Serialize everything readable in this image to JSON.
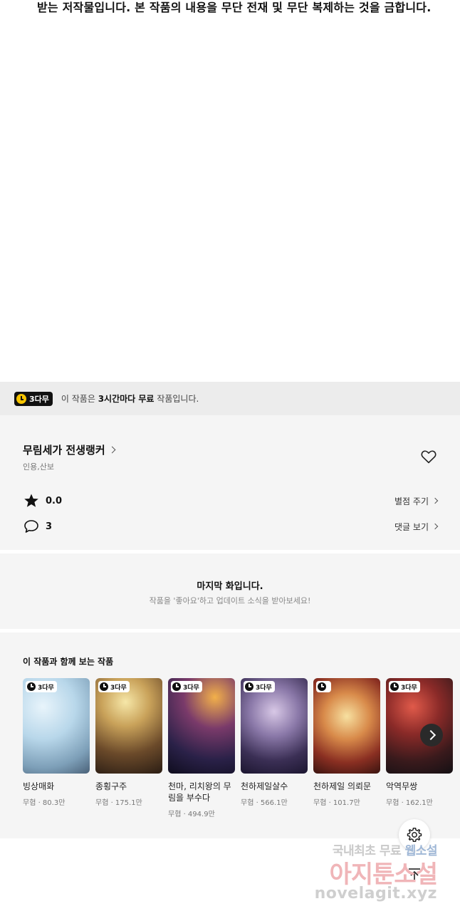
{
  "copyright_line": "받는 저작물입니다. 본 작품의 내용을 무단 전재 및 무단 복제하는 것을 금합니다.",
  "free_banner": {
    "badge": "3다무",
    "prefix": "이 작품은 ",
    "bold": "3시간마다 무료",
    "suffix": " 작품입니다."
  },
  "series": {
    "title": "무림세가 전생랭커",
    "authors": "인용,산보",
    "rating": "0.0",
    "rate_action": "별점 주기",
    "comments": "3",
    "comments_action": "댓글 보기"
  },
  "last_episode": {
    "title": "마지막 화입니다.",
    "subtitle": "작품을 '좋아요'하고 업데이트 소식을 받아보세요!"
  },
  "recommendations": {
    "heading": "이 작품과 함께 보는 작품",
    "badge": "3다무",
    "items": [
      {
        "name": "빙상매화",
        "meta": "무협 · 80.3만"
      },
      {
        "name": "종횡구주",
        "meta": "무협 · 175.1만"
      },
      {
        "name": "천마, 리치왕의 무림을 부수다",
        "meta": "무협 · 494.9만"
      },
      {
        "name": "천하제일살수",
        "meta": "무협 · 566.1만"
      },
      {
        "name": "천하제일 의뢰문",
        "meta": "무협 · 101.7만"
      },
      {
        "name": "악역무쌍",
        "meta": "무협 · 162.1만"
      }
    ]
  },
  "watermark": {
    "line1a": "국내최초 무료 ",
    "line1b": "웹소설",
    "line2": "아지툰소설",
    "line3": "novelagit.xyz"
  },
  "colors": {
    "badge_clock": "#f6c400",
    "banner_bg": "#ececec",
    "section_bg": "#f5f5f5"
  }
}
